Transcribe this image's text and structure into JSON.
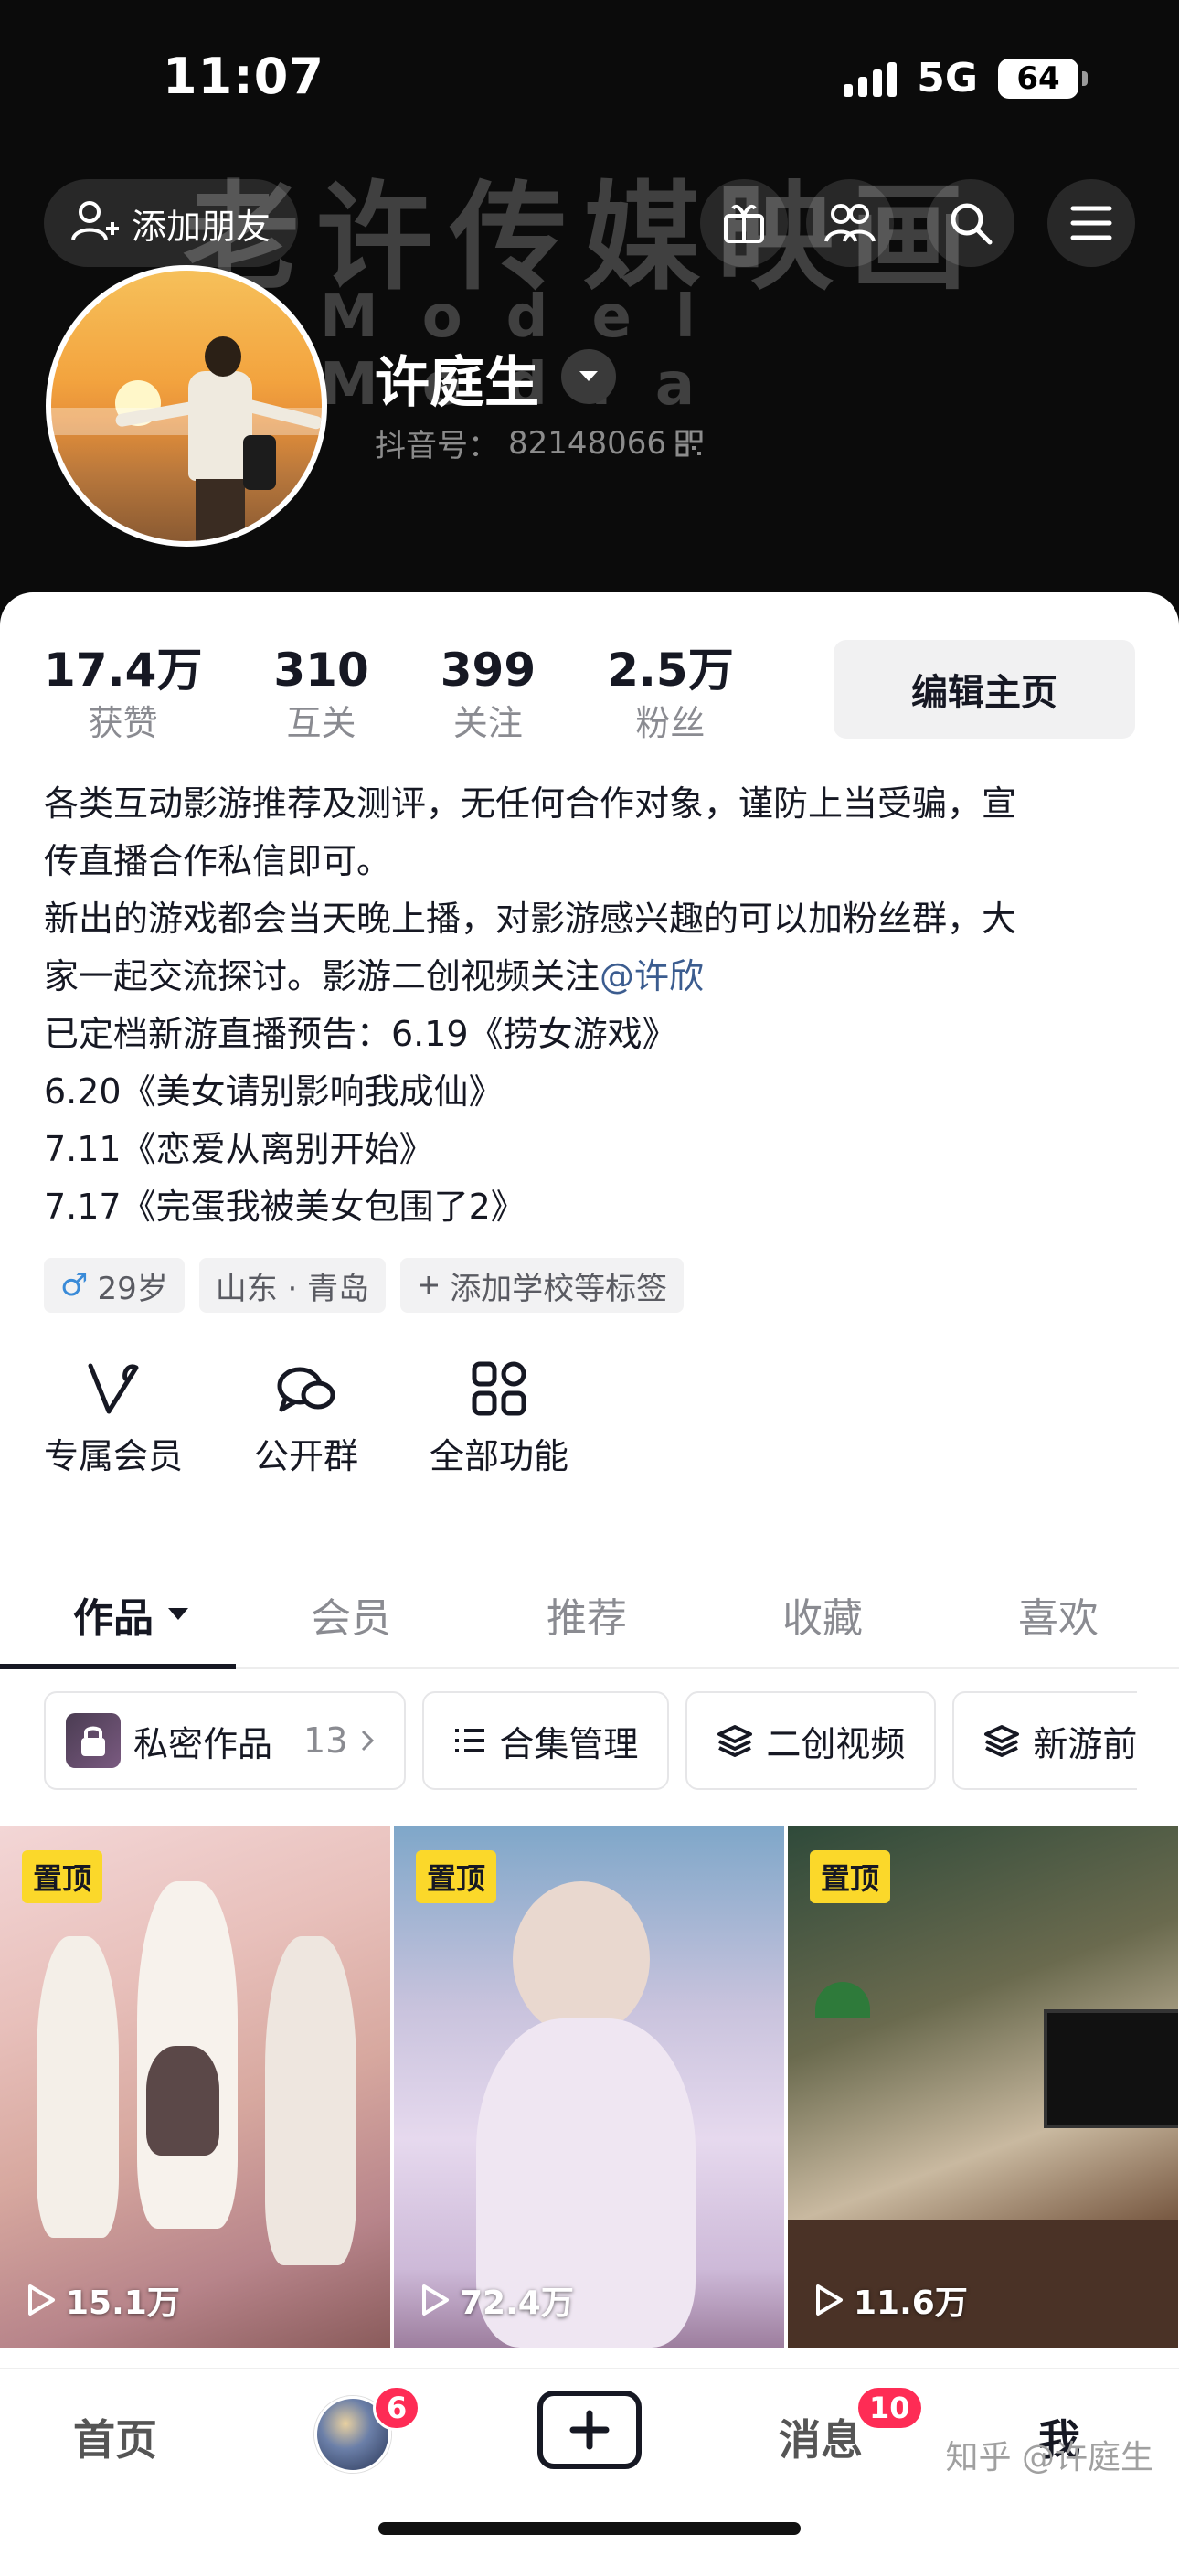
{
  "status_bar": {
    "time": "11:07",
    "network": "5G",
    "battery": "64"
  },
  "header": {
    "add_friend_label": "添加朋友",
    "watermark_cn": "老许传媒映画",
    "watermark_en": "Model Media",
    "icons": [
      "gift-icon",
      "friends-icon",
      "search-icon",
      "menu-icon"
    ]
  },
  "profile": {
    "name": "许庭生",
    "douyin_id_label": "抖音号：",
    "douyin_id": "82148066"
  },
  "stats": [
    {
      "num": "17.4万",
      "label": "获赞"
    },
    {
      "num": "310",
      "label": "互关"
    },
    {
      "num": "399",
      "label": "关注"
    },
    {
      "num": "2.5万",
      "label": "粉丝"
    }
  ],
  "edit_button": "编辑主页",
  "bio": {
    "line1": "各类互动影游推荐及测评，无任何合作对象，谨防上当受骗，宣",
    "line2": "传直播合作私信即可。",
    "line3": "新出的游戏都会当天晚上播，对影游感兴趣的可以加粉丝群，大",
    "line4_prefix": "家一起交流探讨。影游二创视频关注",
    "line4_mention": "@许欣",
    "line5": "已定档新游直播预告：6.19《捞女游戏》",
    "line6": "6.20《美女请别影响我成仙》",
    "line7": "7.11《恋爱从离别开始》",
    "line8": "7.17《完蛋我被美女包围了2》"
  },
  "tags": {
    "gender_symbol": "♂",
    "age": "29岁",
    "location": "山东 · 青岛",
    "add_school": "添加学校等标签"
  },
  "features": [
    {
      "label": "专属会员",
      "icon": "v-icon"
    },
    {
      "label": "公开群",
      "icon": "chat-group-icon"
    },
    {
      "label": "全部功能",
      "icon": "grid-icon"
    }
  ],
  "tabs": [
    {
      "label": "作品",
      "active": true
    },
    {
      "label": "会员",
      "active": false
    },
    {
      "label": "推荐",
      "active": false
    },
    {
      "label": "收藏",
      "active": false
    },
    {
      "label": "喜欢",
      "active": false
    }
  ],
  "chips": {
    "private": "私密作品",
    "private_count": "13",
    "collection": "合集管理",
    "remix": "二创视频",
    "new_games": "新游前"
  },
  "videos": [
    {
      "pinned": "置顶",
      "plays": "15.1万"
    },
    {
      "pinned": "置顶",
      "plays": "72.4万"
    },
    {
      "pinned": "置顶",
      "plays": "11.6万"
    }
  ],
  "bottom_nav": {
    "home": "首页",
    "friends_badge": "6",
    "messages": "消息",
    "messages_badge": "10",
    "me": "我",
    "zhihu_watermark": "知乎 @许庭生"
  },
  "colors": {
    "accent_red": "#fe2c55",
    "pin_yellow": "#fbd82a",
    "mention_blue": "#3b5c8f"
  }
}
